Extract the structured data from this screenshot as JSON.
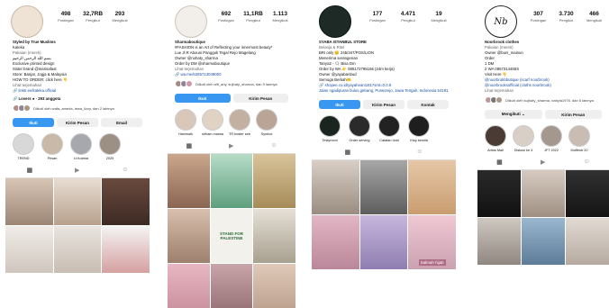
{
  "p1": {
    "stats": [
      {
        "n": "498",
        "l": "Postingan"
      },
      {
        "n": "32,7RB",
        "l": "Pengikut"
      },
      {
        "n": "293",
        "l": "Mengikuti"
      }
    ],
    "bio": [
      "Styled by True Muslims",
      "Kaleka",
      "Pakaian (merek)",
      "بسم الله الرحمن الرحيم",
      "Exclusive printed design",
      "Sister brand @marisafast",
      "Store: Banjar, Jogja & Malaysia",
      "HOW TO ORDER: click here 👇",
      "Lihat terjemahan",
      "🔗 linktr.ee/kaleka.official"
    ],
    "group_text": "🔗 Lovers ● · 293 anggota",
    "followed_by": "Diikuti oleh wafa, ameda, lewa_lizzy, dan 2 lainnya",
    "buttons": [
      "Ikuti",
      "Kirim Pesan",
      "Email"
    ],
    "highlights": [
      "TREND",
      "Pesan",
      "Lt.Koleksi",
      "2025"
    ]
  },
  "p2": {
    "stats": [
      {
        "n": "692",
        "l": "Postingan"
      },
      {
        "n": "11,1RB",
        "l": "Pengikut"
      },
      {
        "n": "1.113",
        "l": "Mengikuti"
      }
    ],
    "bio": [
      "Sharmaboutique",
      "#FASHION is an Art of Reflecting your innermost beauty*",
      "Lue Jl.R Abouni Panggok Tegal Rejo Magelang",
      "Owner @nohaty_sharma",
      "Order by DM @sharmaboutique",
      "Lihat terjemahan",
      "🔗 wa.me/6285713049000"
    ],
    "followed_by": "Diikuti oleh alif_ariy, sujhaty_sharma, dan 5 lainnya",
    "buttons": [
      "Ikuti",
      "Kirim Pesan"
    ],
    "highlights": [
      "Hanimalk",
      "sirham marwa",
      "TR boster sebati",
      "Symbol"
    ],
    "post_text": "STAND FOR PALESTINE"
  },
  "p3": {
    "stats": [
      {
        "n": "177",
        "l": "Postingan"
      },
      {
        "n": "4.471",
        "l": "Pengikut"
      },
      {
        "n": "19",
        "l": "Mengikuti"
      }
    ],
    "bio": [
      "SYABA ISTANBUL STORE",
      "Belanja & Ritel",
      "BRI only 😊 245/347/POS/LION",
      "Menerima serangenan",
      "Tanya2 - 🗨 Bisa Dm",
      "Order by WA 👉 085172795166 (24m kerja)",
      "Owner @yayabanbud",
      "Semoga Berkah🤲",
      "🔗 shopee.co.id/yayaheani1817smt=0.0.9",
      "Jalan ngadipuran bulus,gebang, Purworejo, Jawa Tengah, Indonesia 54191"
    ],
    "buttons": [
      "Ikuti",
      "Kirim Pesan",
      "Kontak"
    ],
    "highlights": [
      "Testymoni",
      "Order serving",
      "Catatan hold",
      "Ktoy kemila"
    ],
    "post_text": "Salmah hijab"
  },
  "p4": {
    "stats": [
      {
        "n": "307",
        "l": "Postingan"
      },
      {
        "n": "3.730",
        "l": "Pengikut"
      },
      {
        "n": "466",
        "l": "Mengikuti"
      }
    ],
    "bio": [
      "Noorbrook clothes",
      "Pakaian (merek)",
      "Owner @buni_mainun",
      "Order",
      "1 DM",
      "2 WA 0857314465S",
      "Visit Here 👇",
      "@noorbrokbbutique (scarf noorbrook)",
      "@noorbrooksofficial (cloths noorbrook)",
      "Lihat terjemahan"
    ],
    "followed_by": "Diikuti oleh sujhaty_sharma, nabyla1976, dan 6 lainnya",
    "buttons": [
      "Mengikuti ⌄",
      "Kirim Pesan"
    ],
    "highlights": [
      "Aritos Mall",
      "Diskusi ke 3",
      "JFT 2022",
      "Muffestr 20"
    ]
  },
  "colors": {
    "follow_blue": "#3897f0",
    "link": "#1a4fa3"
  }
}
